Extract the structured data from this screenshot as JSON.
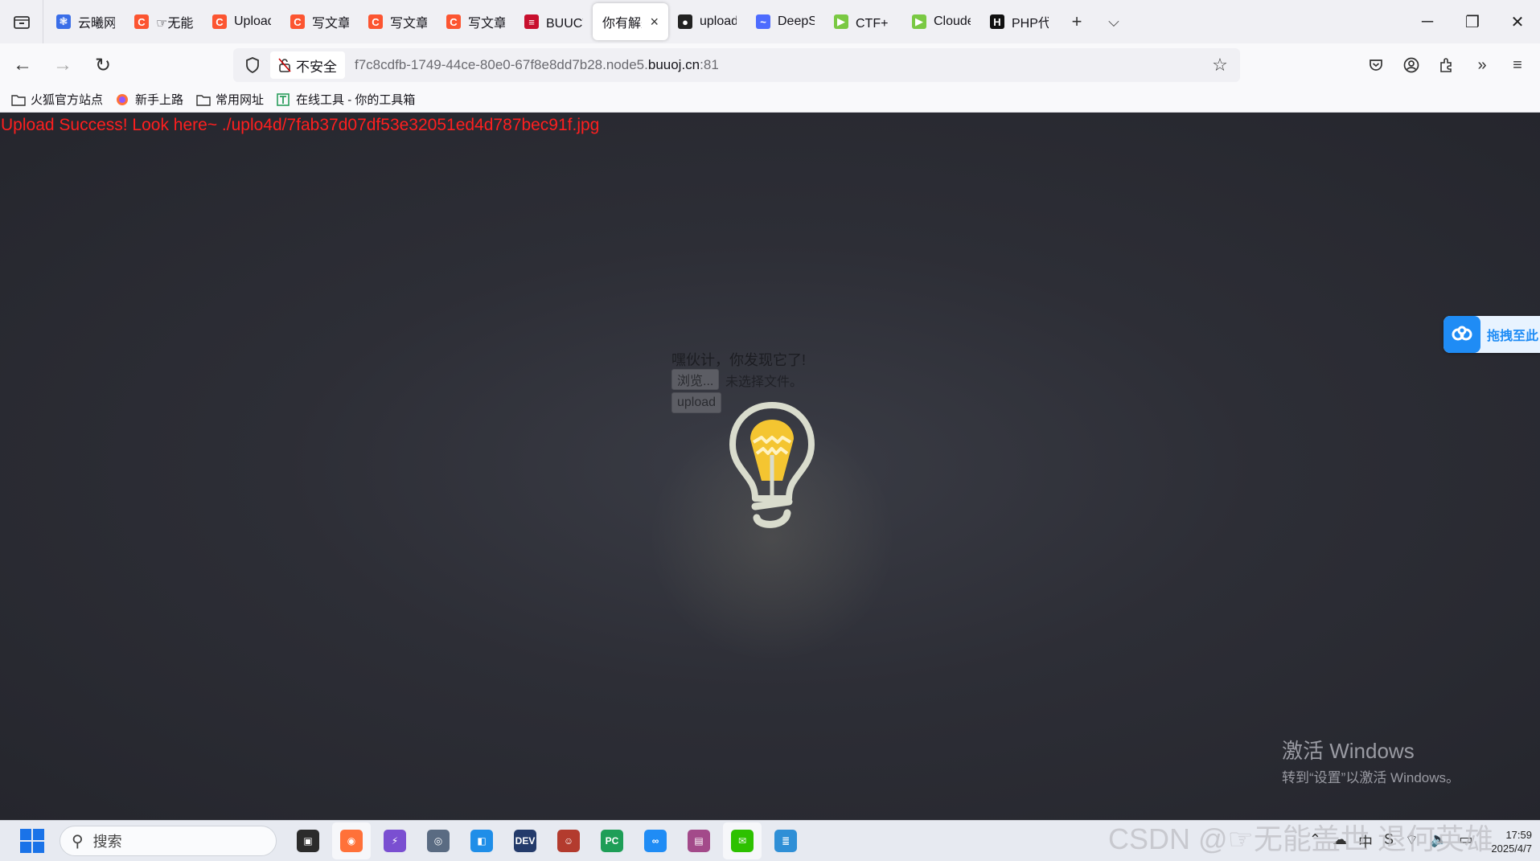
{
  "browser": {
    "tabs": [
      {
        "label": "云曦网络安",
        "color": "#3a6ee8",
        "glyph": "❃"
      },
      {
        "label": "☞无能盖世",
        "color": "#fc5531",
        "glyph": "C"
      },
      {
        "label": "Upload-la",
        "color": "#fc5531",
        "glyph": "C"
      },
      {
        "label": "写文章-CS",
        "color": "#fc5531",
        "glyph": "C"
      },
      {
        "label": "写文章-CS",
        "color": "#fc5531",
        "glyph": "C"
      },
      {
        "label": "写文章-CS",
        "color": "#fc5531",
        "glyph": "C"
      },
      {
        "label": "BUUCTF在",
        "color": "#c8102e",
        "glyph": "≡"
      },
      {
        "label": "你有解题思",
        "color": "#ffffff",
        "glyph": "",
        "active": true
      },
      {
        "label": "upload-la",
        "color": "#222222",
        "glyph": "●"
      },
      {
        "label": "DeepSeek",
        "color": "#4d6bfe",
        "glyph": "~"
      },
      {
        "label": "CTF+ 比赛",
        "color": "#7ac943",
        "glyph": "▶"
      },
      {
        "label": "Cloudeve",
        "color": "#7ac943",
        "glyph": "▶"
      },
      {
        "label": "PHP代码审",
        "color": "#111111",
        "glyph": "H"
      }
    ],
    "active_close": "×",
    "new_tab": "+",
    "tab_overflow": "⌵",
    "address": {
      "security_label": "不安全",
      "url_prefix": "f7c8cdfb-1749-44ce-80e0-67f8e8dd7b28.node5.",
      "url_domain": "buuoj.cn",
      "url_suffix": ":81"
    },
    "bookmarks": [
      {
        "label": "火狐官方站点",
        "icon": "folder-icon"
      },
      {
        "label": "新手上路",
        "icon": "firefox-icon"
      },
      {
        "label": "常用网址",
        "icon": "folder-icon"
      },
      {
        "label": "在线工具 - 你的工具箱",
        "icon": "toolbox-icon"
      }
    ]
  },
  "page": {
    "success_message": "Upload Success! Look here~ ./uplo4d/7fab37d07df53e32051ed4d787bec91f.jpg",
    "hint": "嘿伙计，你发现它了!",
    "browse_label": "浏览...",
    "no_file_label": "未选择文件。",
    "upload_label": "upload",
    "baidu_widget_label": "拖拽至此"
  },
  "activation": {
    "title": "激活 Windows",
    "subtitle": "转到“设置”以激活 Windows。"
  },
  "taskbar": {
    "search_placeholder": "搜索",
    "apps": [
      {
        "name": "task-view",
        "color": "#2b2b2b",
        "glyph": "▣"
      },
      {
        "name": "firefox",
        "color": "#ff7139",
        "glyph": "◉",
        "active": true
      },
      {
        "name": "visual-studio",
        "color": "#7a4fd1",
        "glyph": "⚡"
      },
      {
        "name": "clash",
        "color": "#5a6b82",
        "glyph": "◎"
      },
      {
        "name": "vmware",
        "color": "#1f8ee8",
        "glyph": "◧"
      },
      {
        "name": "dev-cpp",
        "color": "#243b6b",
        "glyph": "DEV"
      },
      {
        "name": "avatar-app",
        "color": "#b33b2e",
        "glyph": "☺"
      },
      {
        "name": "pycharm",
        "color": "#1e9e57",
        "glyph": "PC"
      },
      {
        "name": "baidu-netdisk",
        "color": "#1f8cf5",
        "glyph": "∞"
      },
      {
        "name": "winrar",
        "color": "#a34a8a",
        "glyph": "▤"
      },
      {
        "name": "wechat",
        "color": "#2dc100",
        "glyph": "✉",
        "active": true
      },
      {
        "name": "notepad",
        "color": "#2f8fd6",
        "glyph": "≣"
      }
    ],
    "tray_icons": [
      "⌃",
      "☁",
      "中",
      "S",
      "⌔",
      "🔈",
      "▭"
    ],
    "time": "17:59",
    "date": "2025/4/7"
  },
  "watermark": "CSDN @☞无能盖世 退何英雄"
}
